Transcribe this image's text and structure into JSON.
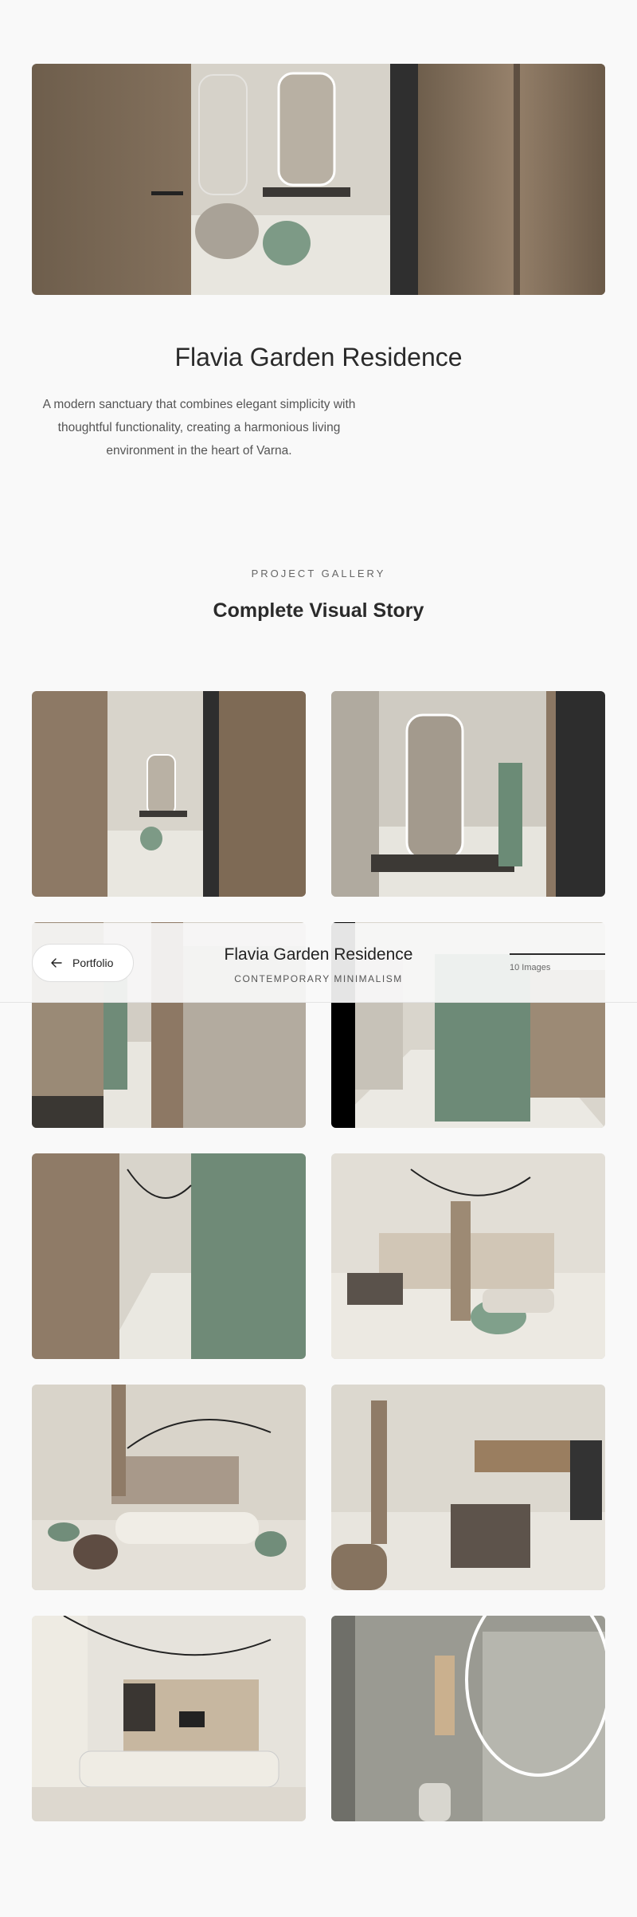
{
  "project": {
    "title": "Flavia Garden Residence",
    "description": "A modern sanctuary that combines elegant simplicity with thoughtful functionality, creating a harmonious living environment in the heart of Varna."
  },
  "gallery": {
    "label": "PROJECT GALLERY",
    "title": "Complete Visual Story"
  },
  "sticky_header": {
    "back_label": "Portfolio",
    "project_name": "Flavia Garden Residence",
    "style": "CONTEMPORARY MINIMALISM",
    "count_label": "10 Images"
  },
  "colors": {
    "background": "#f9f9f9",
    "wood": "#8a7560",
    "sage": "#7d9a86",
    "text": "#2b2b2b"
  }
}
